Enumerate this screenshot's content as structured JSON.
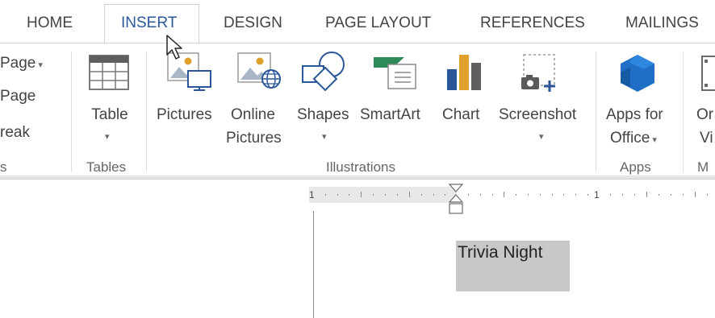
{
  "tabs": [
    {
      "label": "HOME"
    },
    {
      "label": "INSERT"
    },
    {
      "label": "DESIGN"
    },
    {
      "label": "PAGE LAYOUT"
    },
    {
      "label": "REFERENCES"
    },
    {
      "label": "MAILINGS"
    }
  ],
  "active_tab": "INSERT",
  "ribbon": {
    "pages_group": {
      "items": [
        "Page",
        "Page",
        "reak"
      ],
      "label": "s"
    },
    "tables_group": {
      "table_label": "Table",
      "label": "Tables"
    },
    "illustrations_group": {
      "pictures_label": "Pictures",
      "online_label_1": "Online",
      "online_label_2": "Pictures",
      "shapes_label": "Shapes",
      "smartart_label": "SmartArt",
      "chart_label": "Chart",
      "screenshot_label": "Screenshot",
      "label": "Illustrations"
    },
    "apps_group": {
      "apps_label_1": "Apps for",
      "apps_label_2": "Office",
      "label": "Apps"
    },
    "media_group": {
      "label_1": "Or",
      "label_2": "Vi",
      "label": "M"
    }
  },
  "ruler": {
    "mark_left": "1",
    "mark_right": "1"
  },
  "document": {
    "text": "Trivia Night"
  },
  "colors": {
    "active_tab": "#2b579a",
    "apps_icon": "#1e6fc5",
    "chart_orange": "#e0a12c"
  }
}
